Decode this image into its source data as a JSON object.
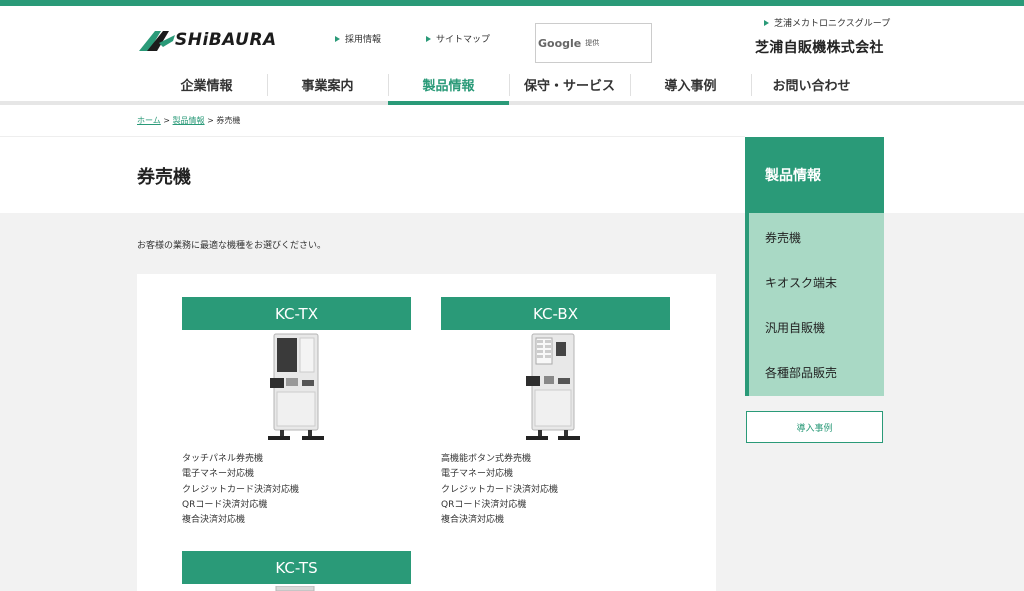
{
  "header": {
    "logo_text": "SHiBAURA",
    "links": [
      "採用情報",
      "サイトマップ"
    ],
    "search_brand": "Google",
    "search_sub": "提供",
    "group_link": "芝浦メカトロニクスグループ",
    "company_name": "芝浦自販機株式会社"
  },
  "nav": {
    "items": [
      "企業情報",
      "事業案内",
      "製品情報",
      "保守・サービス",
      "導入事例",
      "お問い合わせ"
    ],
    "active": "製品情報"
  },
  "breadcrumb": {
    "home": "ホーム",
    "sep": " > ",
    "parent": "製品情報",
    "current": "券売機"
  },
  "page": {
    "title": "券売機",
    "lead": "お客様の業務に最適な機種をお選びください。"
  },
  "products": [
    {
      "name": "KC-TX",
      "features": [
        "タッチパネル券売機",
        "電子マネー対応機",
        "クレジットカード決済対応機",
        "QRコード決済対応機",
        "複合決済対応機"
      ]
    },
    {
      "name": "KC-BX",
      "features": [
        "高機能ボタン式券売機",
        "電子マネー対応機",
        "クレジットカード決済対応機",
        "QRコード決済対応機",
        "複合決済対応機"
      ]
    },
    {
      "name": "KC-TS",
      "features": []
    }
  ],
  "sidebar": {
    "heading": "製品情報",
    "items": [
      "券売機",
      "キオスク端末",
      "汎用自販機",
      "各種部品販売"
    ],
    "button": "導入事例"
  },
  "colors": {
    "brand": "#2a9a78",
    "sidebar_bg": "#a9d9c5",
    "page_bg": "#f2f2f2"
  }
}
